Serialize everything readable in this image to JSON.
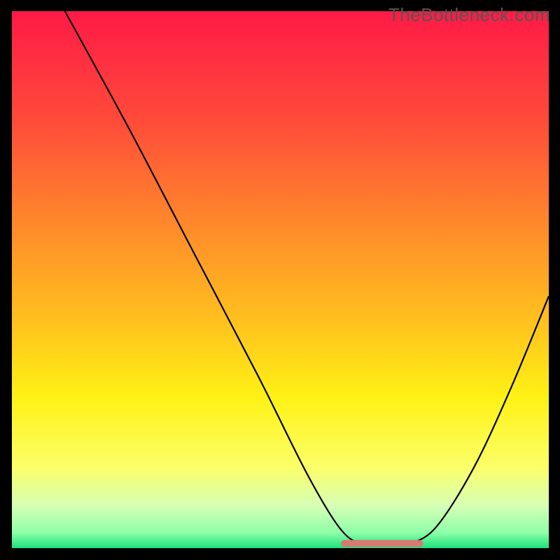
{
  "watermark": "TheBottleneck.com",
  "chart_data": {
    "type": "line",
    "title": "",
    "xlabel": "",
    "ylabel": "",
    "xlim": [
      0,
      100
    ],
    "ylim": [
      0,
      100
    ],
    "grid": false,
    "legend": null,
    "annotations": [],
    "gradient_stops": [
      {
        "offset": 0.0,
        "color": "#ff1a46"
      },
      {
        "offset": 0.2,
        "color": "#ff4a3a"
      },
      {
        "offset": 0.4,
        "color": "#ff8a2a"
      },
      {
        "offset": 0.58,
        "color": "#ffc21e"
      },
      {
        "offset": 0.72,
        "color": "#fff215"
      },
      {
        "offset": 0.85,
        "color": "#fbff6a"
      },
      {
        "offset": 0.92,
        "color": "#d6ffb6"
      },
      {
        "offset": 0.97,
        "color": "#8effa8"
      },
      {
        "offset": 1.0,
        "color": "#16e07a"
      }
    ],
    "series": [
      {
        "name": "bottleneck-curve",
        "color": "#000000",
        "points": [
          {
            "x": 10,
            "y": 100
          },
          {
            "x": 22,
            "y": 78
          },
          {
            "x": 34,
            "y": 55
          },
          {
            "x": 46,
            "y": 32
          },
          {
            "x": 55,
            "y": 14
          },
          {
            "x": 61,
            "y": 4
          },
          {
            "x": 65,
            "y": 1
          },
          {
            "x": 70,
            "y": 1
          },
          {
            "x": 74,
            "y": 1
          },
          {
            "x": 79,
            "y": 4
          },
          {
            "x": 86,
            "y": 15
          },
          {
            "x": 93,
            "y": 30
          },
          {
            "x": 100,
            "y": 47
          }
        ]
      }
    ],
    "flat_segment": {
      "name": "optimal-range",
      "color": "#d77a72",
      "x_start": 62,
      "x_end": 76,
      "y": 1
    }
  }
}
